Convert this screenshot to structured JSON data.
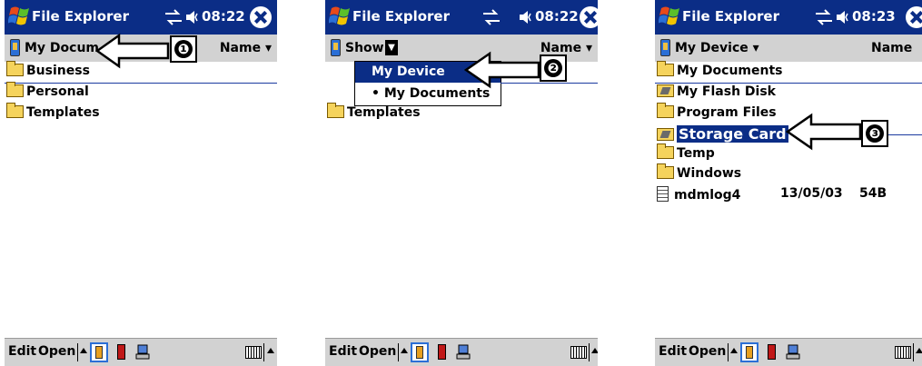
{
  "panels": [
    {
      "title": "File Explorer",
      "time": "08:22",
      "header_label": "My Docum",
      "sort_label": "Name",
      "items": [
        "Business",
        "Personal",
        "Templates"
      ],
      "callout": "❶"
    },
    {
      "title": "File Explorer",
      "time": "08:22",
      "header_label": "Show",
      "sort_label": "Name",
      "menu": [
        "My Device",
        "• My Documents"
      ],
      "items": [
        "Templates"
      ],
      "callout": "❷"
    },
    {
      "title": "File Explorer",
      "time": "08:23",
      "header_label": "My Device",
      "sort_label": "Name",
      "items": [
        "My Documents",
        "My Flash Disk",
        "Program Files",
        "Storage Card",
        "Temp",
        "Windows"
      ],
      "file": {
        "name": "mdmlog4",
        "date": "13/05/03",
        "size": "54B"
      },
      "callout": "❸"
    }
  ],
  "toolbar": {
    "edit": "Edit",
    "open": "Open"
  }
}
